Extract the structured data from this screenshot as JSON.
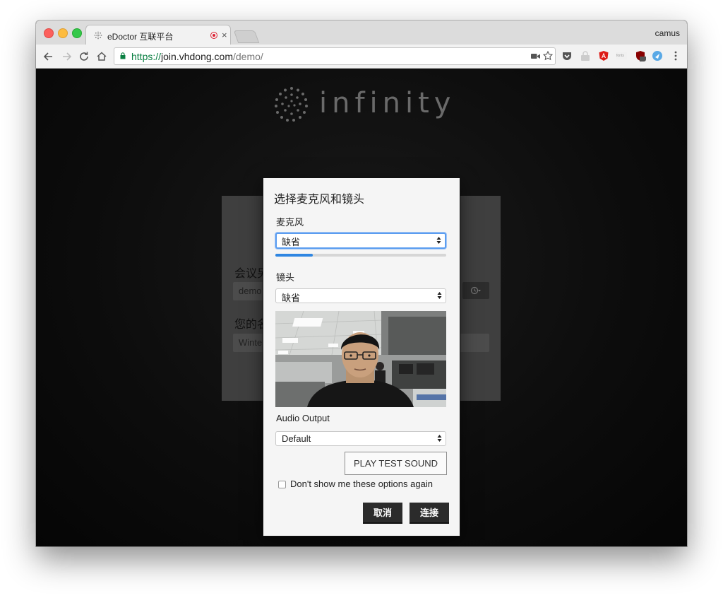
{
  "browser": {
    "tab": {
      "title": "eDoctor 互联平台",
      "close": "×"
    },
    "profile": "camus",
    "url": {
      "scheme": "https://",
      "host": "join.vhdong.com",
      "path": "/demo/"
    }
  },
  "page": {
    "logo_text": "infinity",
    "background_form": {
      "conference_label": "会议另",
      "conference_value": "demo",
      "name_label": "您的名",
      "name_value": "Winte"
    }
  },
  "dialog": {
    "title": "选择麦克风和镜头",
    "microphone": {
      "label": "麦克风",
      "selected": "缺省",
      "level": 0.22
    },
    "camera": {
      "label": "镜头",
      "selected": "缺省"
    },
    "audio_output": {
      "label": "Audio Output",
      "selected": "Default"
    },
    "play_test_sound": "PLAY TEST SOUND",
    "dont_show_again": "Don't show me these options again",
    "cancel": "取消",
    "connect": "连接"
  }
}
